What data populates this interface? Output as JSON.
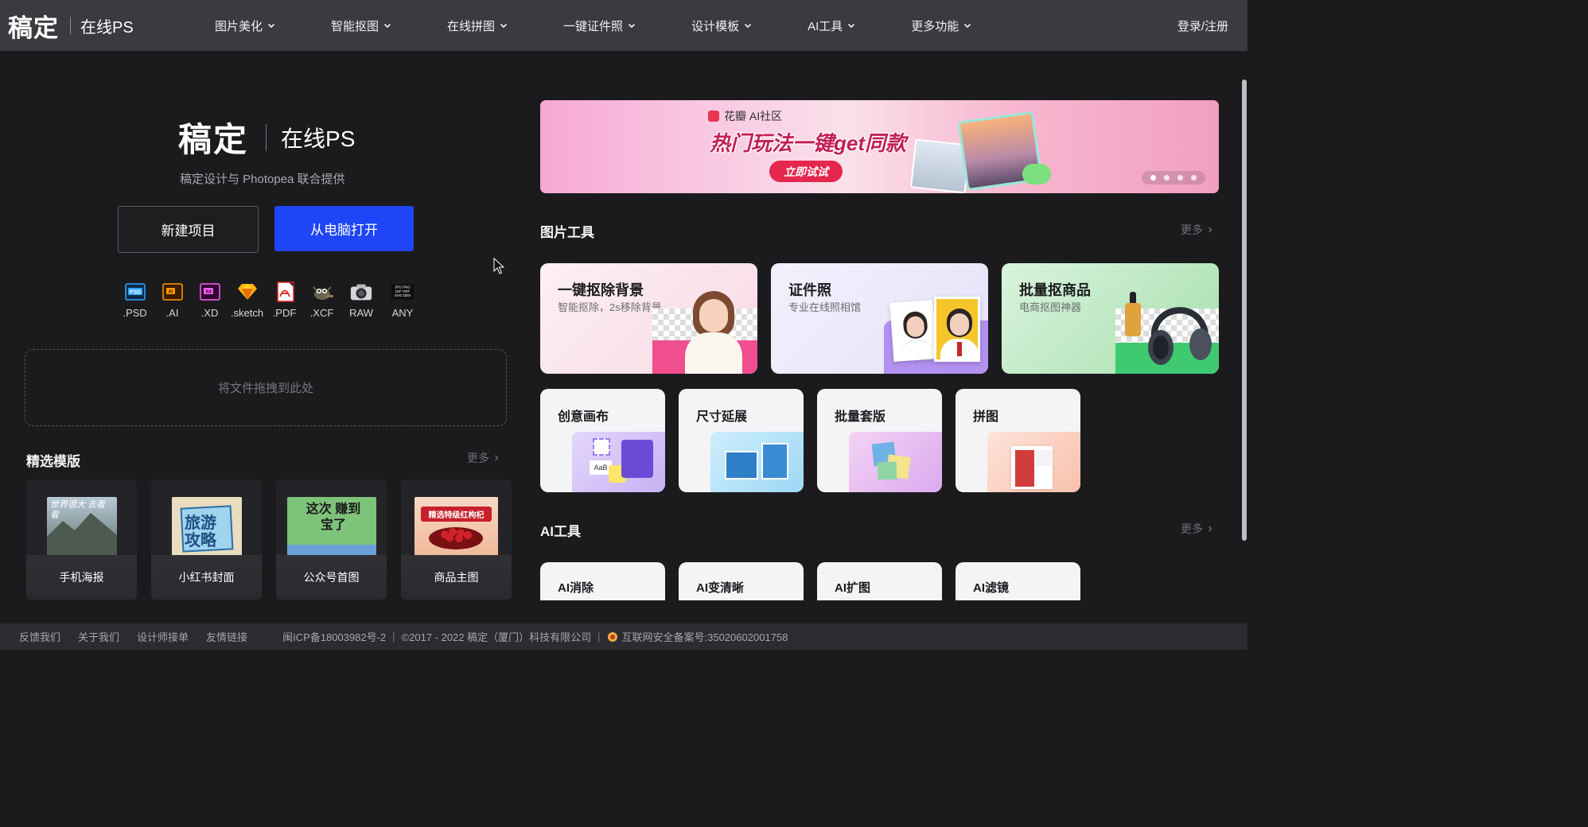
{
  "brand": {
    "logo": "稿定",
    "sub": "在线PS"
  },
  "nav": [
    {
      "label": "图片美化"
    },
    {
      "label": "智能抠图"
    },
    {
      "label": "在线拼图"
    },
    {
      "label": "一键证件照"
    },
    {
      "label": "设计模板"
    },
    {
      "label": "AI工具"
    },
    {
      "label": "更多功能"
    }
  ],
  "login": "登录/注册",
  "hero": {
    "logo": "稿定",
    "sub": "在线PS",
    "tagline": "稿定设计与 Photopea 联合提供",
    "new_btn": "新建项目",
    "open_btn": "从电脑打开"
  },
  "formats": [
    {
      "icon": "psd-file-icon",
      "label": ".PSD"
    },
    {
      "icon": "ai-file-icon",
      "label": ".AI"
    },
    {
      "icon": "xd-file-icon",
      "label": ".XD"
    },
    {
      "icon": "sketch-file-icon",
      "label": ".sketch"
    },
    {
      "icon": "pdf-file-icon",
      "label": ".PDF"
    },
    {
      "icon": "xcf-file-icon",
      "label": ".XCF"
    },
    {
      "icon": "camera-raw-icon",
      "label": "RAW"
    },
    {
      "icon": "any-file-icon",
      "label": "ANY",
      "tag": "JPG PNG GIF TIFF SVG DDS"
    }
  ],
  "dropzone": "将文件拖拽到此处",
  "templates": {
    "title": "精选模版",
    "more": "更多",
    "items": [
      {
        "label": "手机海报",
        "thumb_text": "世界很大 去看看"
      },
      {
        "label": "小红书封面",
        "thumb_text": "旅游攻略"
      },
      {
        "label": "公众号首图",
        "thumb_text": "这次 赚到宝了"
      },
      {
        "label": "商品主图",
        "thumb_text": "精选特级红枸杞"
      }
    ]
  },
  "banner": {
    "brand": "花瓣 AI社区",
    "title": "热门玩法一键get同款",
    "cta": "立即试试",
    "dots": 4,
    "active_dot": 0
  },
  "image_tools": {
    "title": "图片工具",
    "more": "更多",
    "big": [
      {
        "title": "一键抠除背景",
        "sub": "智能抠除，2s移除背景",
        "color": "#fbe3ec"
      },
      {
        "title": "证件照",
        "sub": "专业在线照相馆",
        "color": "#ece8fb"
      },
      {
        "title": "批量抠商品",
        "sub": "电商抠图神器",
        "color": "#bfe8c6"
      }
    ],
    "small": [
      {
        "title": "创意画布"
      },
      {
        "title": "尺寸延展"
      },
      {
        "title": "批量套版"
      },
      {
        "title": "拼图"
      }
    ]
  },
  "ai_tools": {
    "title": "AI工具",
    "more": "更多",
    "items": [
      {
        "title": "AI消除"
      },
      {
        "title": "AI变清晰"
      },
      {
        "title": "AI扩图"
      },
      {
        "title": "AI滤镜"
      }
    ]
  },
  "footer": {
    "links": [
      "反馈我们",
      "关于我们",
      "设计师接单",
      "友情链接"
    ],
    "icp": "闽ICP备18003982号-2",
    "copyright": "©2017 - 2022 稿定（厦门）科技有限公司",
    "security": "互联网安全备案号:35020602001758"
  },
  "colors": {
    "accent": "#1e45f6",
    "nav_bg": "#3a3a3f",
    "page_bg": "#1b1b1e"
  }
}
